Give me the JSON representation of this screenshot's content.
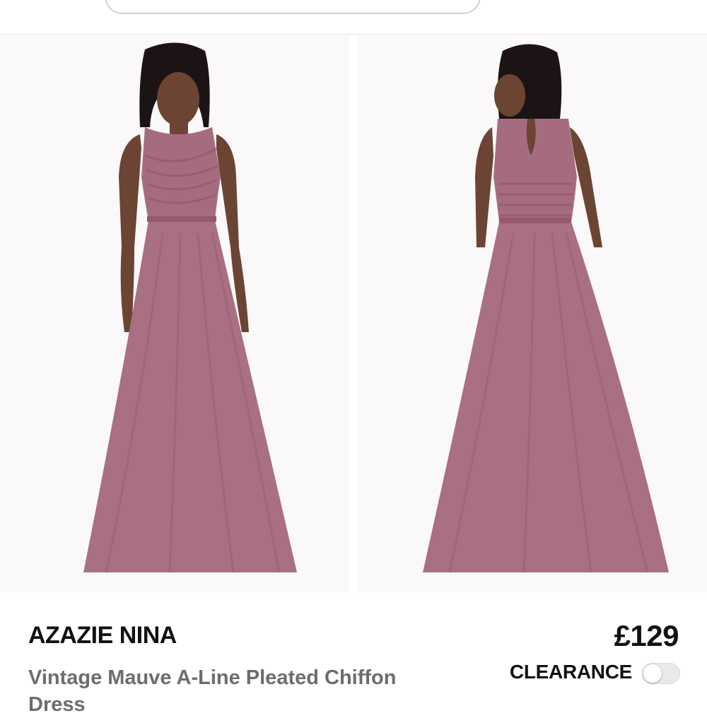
{
  "product": {
    "brand_title": "AZAZIE NINA",
    "price": "£129",
    "description": "Vintage Mauve A-Line Pleated Chiffon Dress",
    "clearance_label": "CLEARANCE",
    "clearance_enabled": false
  },
  "colors": {
    "dress": "#a96f83",
    "background": "#f8f6f6"
  },
  "icons": {
    "toggle": "toggle-switch-icon"
  }
}
